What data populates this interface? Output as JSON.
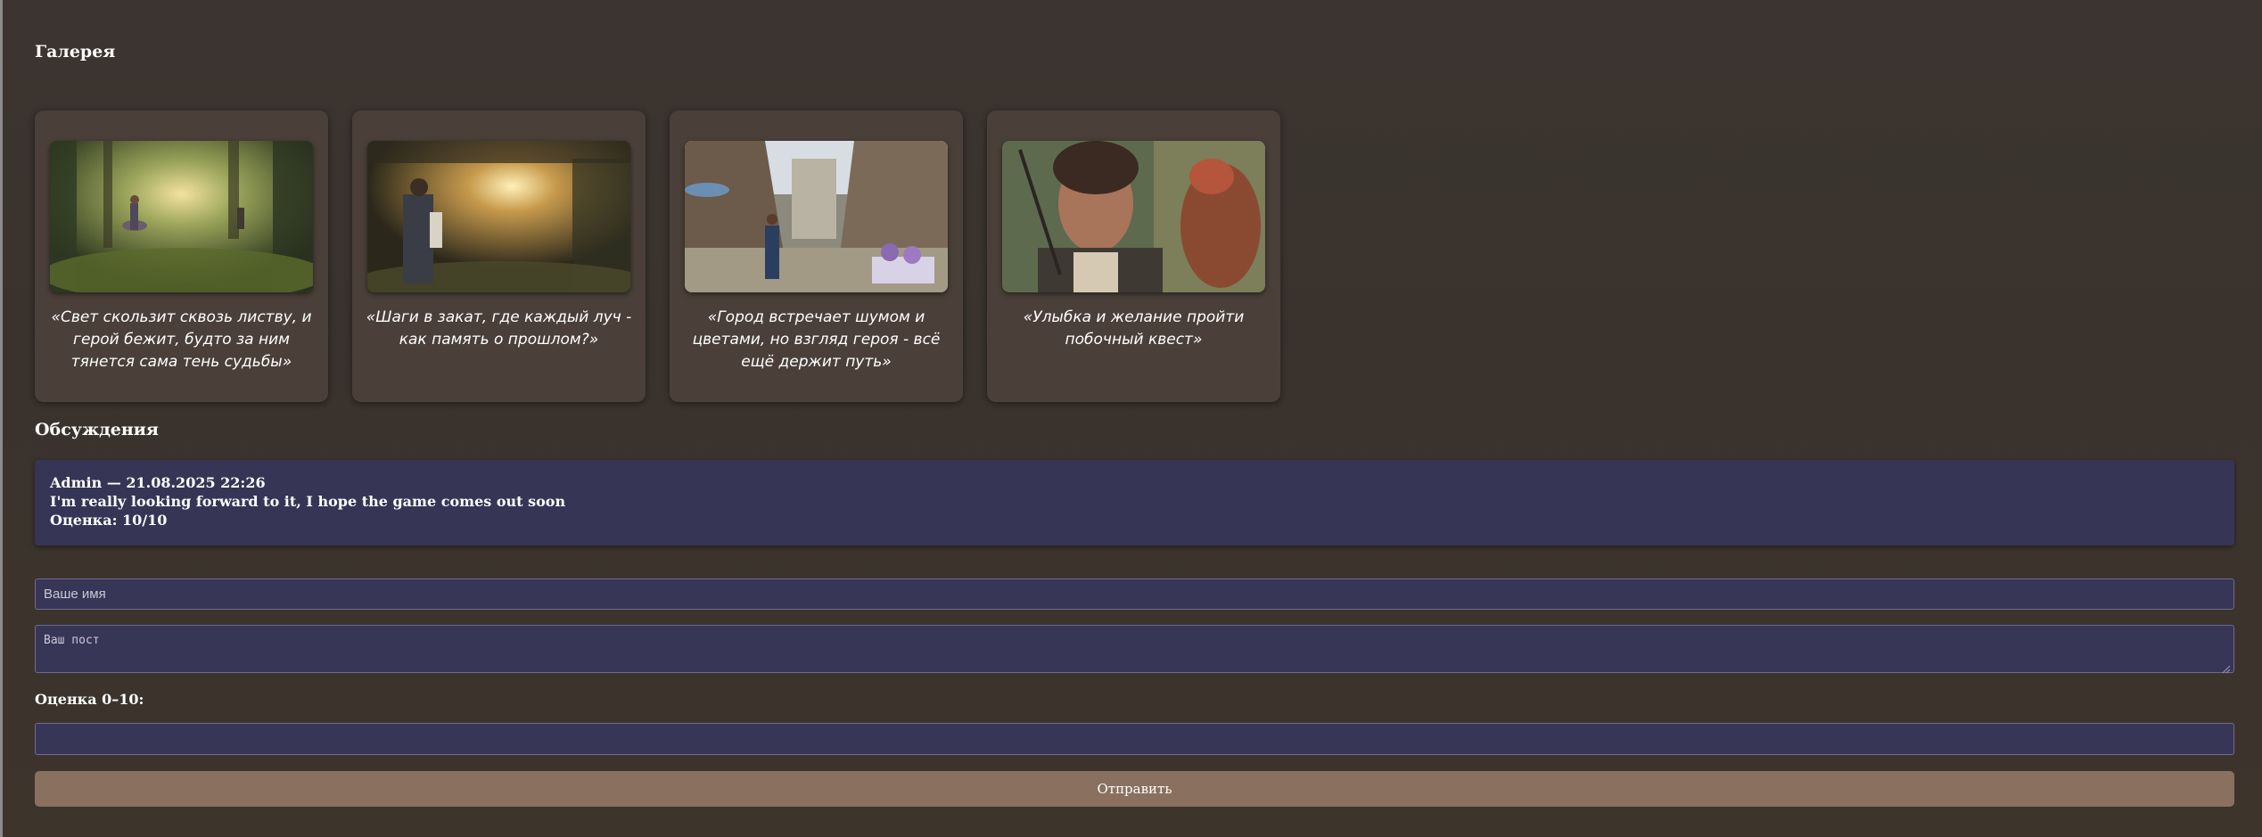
{
  "gallery": {
    "heading": "Галерея",
    "items": [
      {
        "caption": "«Свет скользит сквозь листву, и герой бежит, будто за ним тянется сама тень судьбы»"
      },
      {
        "caption": "«Шаги в закат, где каждый луч - как память о прошлом?»"
      },
      {
        "caption": "«Город встречает шумом и цветами, но взгляд героя - всё ещё держит путь»"
      },
      {
        "caption": "«Улыбка и желание пройти побочный квест»"
      }
    ]
  },
  "discussions": {
    "heading": "Обсуждения",
    "comments": [
      {
        "header": "Admin — 21.08.2025 22:26",
        "text": "I'm really looking forward to it, I hope the game comes out soon",
        "rating": "Оценка: 10/10"
      }
    ]
  },
  "form": {
    "name_placeholder": "Ваше имя",
    "post_placeholder": "Ваш пост",
    "rating_label": "Оценка 0–10:",
    "rating_value": "",
    "submit_label": "Отправить"
  },
  "colors": {
    "background": "#3b3430",
    "card": "#4a4039",
    "comment": "#363556",
    "button": "#8a705e"
  }
}
